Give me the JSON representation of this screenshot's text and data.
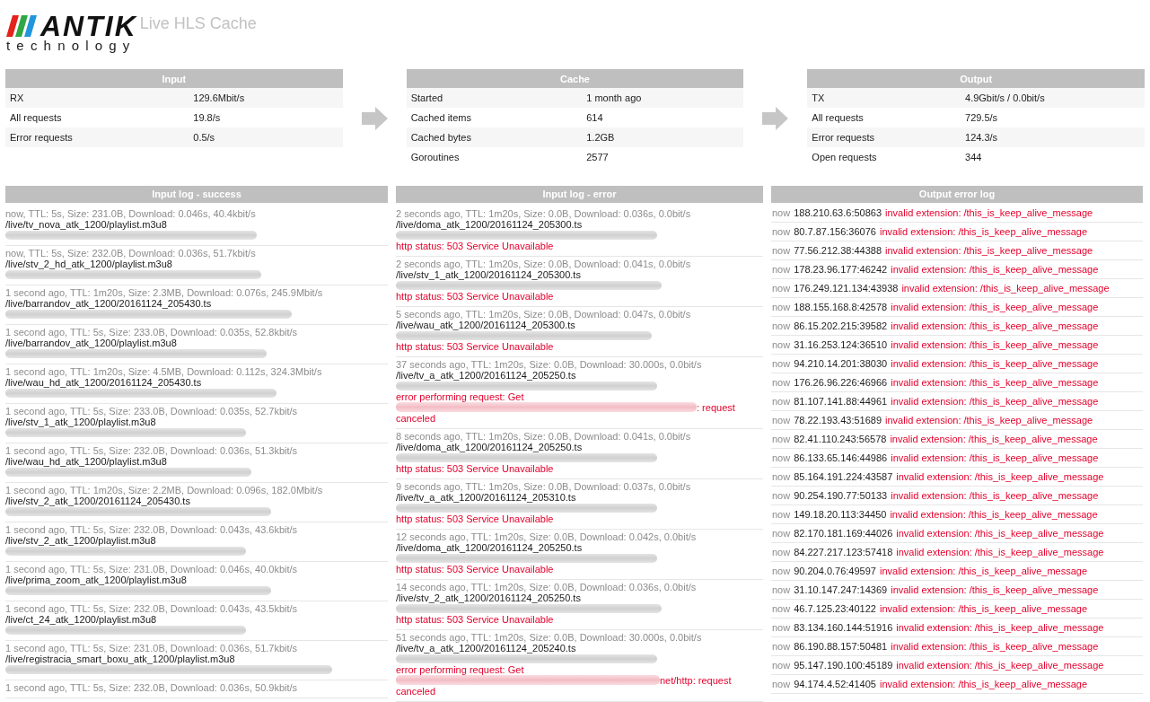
{
  "header": {
    "logo": {
      "wordmark": "ANTIK",
      "tagline": "technology"
    },
    "title": "Live HLS Cache"
  },
  "stats": [
    {
      "title": "Input",
      "rows": [
        {
          "label": "RX",
          "value": "129.6Mbit/s"
        },
        {
          "label": "All requests",
          "value": "19.8/s"
        },
        {
          "label": "Error requests",
          "value": "0.5/s"
        }
      ]
    },
    {
      "title": "Cache",
      "rows": [
        {
          "label": "Started",
          "value": "1 month ago"
        },
        {
          "label": "Cached items",
          "value": "614"
        },
        {
          "label": "Cached bytes",
          "value": "1.2GB"
        },
        {
          "label": "Goroutines",
          "value": "2577"
        }
      ]
    },
    {
      "title": "Output",
      "rows": [
        {
          "label": "TX",
          "value": "4.9Gbit/s / 0.0bit/s"
        },
        {
          "label": "All requests",
          "value": "729.5/s"
        },
        {
          "label": "Error requests",
          "value": "124.3/s"
        },
        {
          "label": "Open requests",
          "value": "344"
        }
      ]
    }
  ],
  "input_log_success": {
    "title": "Input log - success",
    "entries": [
      {
        "meta": "now, TTL: 5s, Size: 231.0B, Download: 0.046s, 40.4kbit/s",
        "path": "/live/tv_nova_atk_1200/playlist.m3u8"
      },
      {
        "meta": "now, TTL: 5s, Size: 232.0B, Download: 0.036s, 51.7kbit/s",
        "path": "/live/stv_2_hd_atk_1200/playlist.m3u8"
      },
      {
        "meta": "1 second ago, TTL: 1m20s, Size: 2.3MB, Download: 0.076s, 245.9Mbit/s",
        "path": "/live/barrandov_atk_1200/20161124_205430.ts"
      },
      {
        "meta": "1 second ago, TTL: 5s, Size: 233.0B, Download: 0.035s, 52.8kbit/s",
        "path": "/live/barrandov_atk_1200/playlist.m3u8"
      },
      {
        "meta": "1 second ago, TTL: 1m20s, Size: 4.5MB, Download: 0.112s, 324.3Mbit/s",
        "path": "/live/wau_hd_atk_1200/20161124_205430.ts"
      },
      {
        "meta": "1 second ago, TTL: 5s, Size: 233.0B, Download: 0.035s, 52.7kbit/s",
        "path": "/live/stv_1_atk_1200/playlist.m3u8"
      },
      {
        "meta": "1 second ago, TTL: 5s, Size: 232.0B, Download: 0.036s, 51.3kbit/s",
        "path": "/live/wau_hd_atk_1200/playlist.m3u8"
      },
      {
        "meta": "1 second ago, TTL: 1m20s, Size: 2.2MB, Download: 0.096s, 182.0Mbit/s",
        "path": "/live/stv_2_atk_1200/20161124_205430.ts"
      },
      {
        "meta": "1 second ago, TTL: 5s, Size: 232.0B, Download: 0.043s, 43.6kbit/s",
        "path": "/live/stv_2_atk_1200/playlist.m3u8"
      },
      {
        "meta": "1 second ago, TTL: 5s, Size: 231.0B, Download: 0.046s, 40.0kbit/s",
        "path": "/live/prima_zoom_atk_1200/playlist.m3u8"
      },
      {
        "meta": "1 second ago, TTL: 5s, Size: 232.0B, Download: 0.043s, 43.5kbit/s",
        "path": "/live/ct_24_atk_1200/playlist.m3u8"
      },
      {
        "meta": "1 second ago, TTL: 5s, Size: 231.0B, Download: 0.036s, 51.7kbit/s",
        "path": "/live/registracia_smart_boxu_atk_1200/playlist.m3u8"
      },
      {
        "meta": "1 second ago, TTL: 5s, Size: 232.0B, Download: 0.036s, 50.9kbit/s"
      }
    ]
  },
  "input_log_error": {
    "title": "Input log - error",
    "entries": [
      {
        "kind": "status",
        "meta": "2 seconds ago, TTL: 1m20s, Size: 0.0B, Download: 0.036s, 0.0bit/s",
        "path": "/live/doma_atk_1200/20161124_205300.ts",
        "error": "http status: 503 Service Unavailable"
      },
      {
        "kind": "status",
        "meta": "2 seconds ago, TTL: 1m20s, Size: 0.0B, Download: 0.041s, 0.0bit/s",
        "path": "/live/stv_1_atk_1200/20161124_205300.ts",
        "error": "http status: 503 Service Unavailable"
      },
      {
        "kind": "status",
        "meta": "5 seconds ago, TTL: 1m20s, Size: 0.0B, Download: 0.047s, 0.0bit/s",
        "path": "/live/wau_atk_1200/20161124_205300.ts",
        "error": "http status: 503 Service Unavailable"
      },
      {
        "kind": "request",
        "meta": "37 seconds ago, TTL: 1m20s, Size: 0.0B, Download: 30.000s, 0.0bit/s",
        "path": "/live/tv_a_atk_1200/20161124_205250.ts",
        "error_lead": "error performing request: Get",
        "error_tail": ": request canceled"
      },
      {
        "kind": "status",
        "meta": "8 seconds ago, TTL: 1m20s, Size: 0.0B, Download: 0.041s, 0.0bit/s",
        "path": "/live/doma_atk_1200/20161124_205250.ts",
        "error": "http status: 503 Service Unavailable"
      },
      {
        "kind": "status",
        "meta": "9 seconds ago, TTL: 1m20s, Size: 0.0B, Download: 0.037s, 0.0bit/s",
        "path": "/live/tv_a_atk_1200/20161124_205310.ts",
        "error": "http status: 503 Service Unavailable"
      },
      {
        "kind": "status",
        "meta": "12 seconds ago, TTL: 1m20s, Size: 0.0B, Download: 0.042s, 0.0bit/s",
        "path": "/live/doma_atk_1200/20161124_205250.ts",
        "error": "http status: 503 Service Unavailable"
      },
      {
        "kind": "status",
        "meta": "14 seconds ago, TTL: 1m20s, Size: 0.0B, Download: 0.036s, 0.0bit/s",
        "path": "/live/stv_2_atk_1200/20161124_205250.ts",
        "error": "http status: 503 Service Unavailable"
      },
      {
        "kind": "request",
        "meta": "51 seconds ago, TTL: 1m20s, Size: 0.0B, Download: 30.000s, 0.0bit/s",
        "path": "/live/tv_a_atk_1200/20161124_205240.ts",
        "error_lead": "error performing request: Get",
        "error_tail": "net/http: request canceled"
      }
    ]
  },
  "output_error_log": {
    "title": "Output error log",
    "entries": [
      {
        "time": "now",
        "client": "188.210.63.6:50863",
        "error": "invalid extension: /this_is_keep_alive_message"
      },
      {
        "time": "now",
        "client": "80.7.87.156:36076",
        "error": "invalid extension: /this_is_keep_alive_message"
      },
      {
        "time": "now",
        "client": "77.56.212.38:44388",
        "error": "invalid extension: /this_is_keep_alive_message"
      },
      {
        "time": "now",
        "client": "178.23.96.177:46242",
        "error": "invalid extension: /this_is_keep_alive_message"
      },
      {
        "time": "now",
        "client": "176.249.121.134:43938",
        "error": "invalid extension: /this_is_keep_alive_message"
      },
      {
        "time": "now",
        "client": "188.155.168.8:42578",
        "error": "invalid extension: /this_is_keep_alive_message"
      },
      {
        "time": "now",
        "client": "86.15.202.215:39582",
        "error": "invalid extension: /this_is_keep_alive_message"
      },
      {
        "time": "now",
        "client": "31.16.253.124:36510",
        "error": "invalid extension: /this_is_keep_alive_message"
      },
      {
        "time": "now",
        "client": "94.210.14.201:38030",
        "error": "invalid extension: /this_is_keep_alive_message"
      },
      {
        "time": "now",
        "client": "176.26.96.226:46966",
        "error": "invalid extension: /this_is_keep_alive_message"
      },
      {
        "time": "now",
        "client": "81.107.141.88:44961",
        "error": "invalid extension: /this_is_keep_alive_message"
      },
      {
        "time": "now",
        "client": "78.22.193.43:51689",
        "error": "invalid extension: /this_is_keep_alive_message"
      },
      {
        "time": "now",
        "client": "82.41.110.243:56578",
        "error": "invalid extension: /this_is_keep_alive_message"
      },
      {
        "time": "now",
        "client": "86.133.65.146:44986",
        "error": "invalid extension: /this_is_keep_alive_message"
      },
      {
        "time": "now",
        "client": "85.164.191.224:43587",
        "error": "invalid extension: /this_is_keep_alive_message"
      },
      {
        "time": "now",
        "client": "90.254.190.77:50133",
        "error": "invalid extension: /this_is_keep_alive_message"
      },
      {
        "time": "now",
        "client": "149.18.20.113:34450",
        "error": "invalid extension: /this_is_keep_alive_message"
      },
      {
        "time": "now",
        "client": "82.170.181.169:44026",
        "error": "invalid extension: /this_is_keep_alive_message"
      },
      {
        "time": "now",
        "client": "84.227.217.123:57418",
        "error": "invalid extension: /this_is_keep_alive_message"
      },
      {
        "time": "now",
        "client": "90.204.0.76:49597",
        "error": "invalid extension: /this_is_keep_alive_message"
      },
      {
        "time": "now",
        "client": "31.10.147.247:14369",
        "error": "invalid extension: /this_is_keep_alive_message"
      },
      {
        "time": "now",
        "client": "46.7.125.23:40122",
        "error": "invalid extension: /this_is_keep_alive_message"
      },
      {
        "time": "now",
        "client": "83.134.160.144:51916",
        "error": "invalid extension: /this_is_keep_alive_message"
      },
      {
        "time": "now",
        "client": "86.190.88.157:50481",
        "error": "invalid extension: /this_is_keep_alive_message"
      },
      {
        "time": "now",
        "client": "95.147.190.100:45189",
        "error": "invalid extension: /this_is_keep_alive_message"
      },
      {
        "time": "now",
        "client": "94.174.4.52:41405",
        "error": "invalid extension: /this_is_keep_alive_message"
      }
    ]
  }
}
